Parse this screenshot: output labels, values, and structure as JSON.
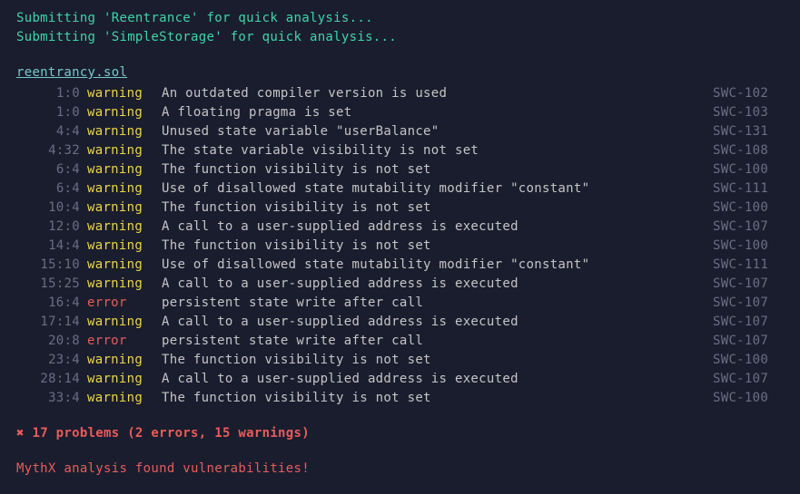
{
  "submissions": [
    "Submitting 'Reentrance' for quick analysis...",
    "Submitting 'SimpleStorage' for quick analysis..."
  ],
  "filename": "reentrancy.sol",
  "issues": [
    {
      "location": "1:0",
      "severity": "warning",
      "message": "An outdated compiler version is used",
      "code": "SWC-102"
    },
    {
      "location": "1:0",
      "severity": "warning",
      "message": "A floating pragma is set",
      "code": "SWC-103"
    },
    {
      "location": "4:4",
      "severity": "warning",
      "message": "Unused state variable \"userBalance\"",
      "code": "SWC-131"
    },
    {
      "location": "4:32",
      "severity": "warning",
      "message": "The state variable visibility is not set",
      "code": "SWC-108"
    },
    {
      "location": "6:4",
      "severity": "warning",
      "message": "The function visibility is not set",
      "code": "SWC-100"
    },
    {
      "location": "6:4",
      "severity": "warning",
      "message": "Use of disallowed state mutability modifier \"constant\"",
      "code": "SWC-111"
    },
    {
      "location": "10:4",
      "severity": "warning",
      "message": "The function visibility is not set",
      "code": "SWC-100"
    },
    {
      "location": "12:0",
      "severity": "warning",
      "message": "A call to a user-supplied address is executed",
      "code": "SWC-107"
    },
    {
      "location": "14:4",
      "severity": "warning",
      "message": "The function visibility is not set",
      "code": "SWC-100"
    },
    {
      "location": "15:10",
      "severity": "warning",
      "message": "Use of disallowed state mutability modifier \"constant\"",
      "code": "SWC-111"
    },
    {
      "location": "15:25",
      "severity": "warning",
      "message": "A call to a user-supplied address is executed",
      "code": "SWC-107"
    },
    {
      "location": "16:4",
      "severity": "error",
      "message": "persistent state write after call",
      "code": "SWC-107"
    },
    {
      "location": "17:14",
      "severity": "warning",
      "message": "A call to a user-supplied address is executed",
      "code": "SWC-107"
    },
    {
      "location": "20:8",
      "severity": "error",
      "message": "persistent state write after call",
      "code": "SWC-107"
    },
    {
      "location": "23:4",
      "severity": "warning",
      "message": "The function visibility is not set",
      "code": "SWC-100"
    },
    {
      "location": "28:14",
      "severity": "warning",
      "message": "A call to a user-supplied address is executed",
      "code": "SWC-107"
    },
    {
      "location": "33:4",
      "severity": "warning",
      "message": "The function visibility is not set",
      "code": "SWC-100"
    }
  ],
  "summary": {
    "cross": "✖",
    "text": " 17 problems (2 errors, 15 warnings)"
  },
  "footer": "MythX analysis found vulnerabilities!"
}
